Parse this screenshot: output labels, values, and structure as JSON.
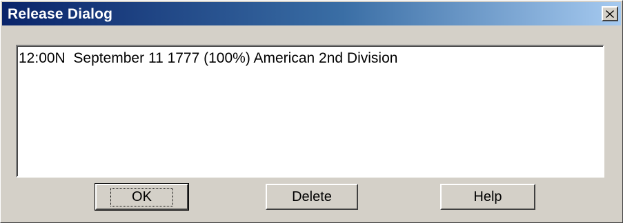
{
  "window": {
    "title": "Release Dialog"
  },
  "icons": {
    "close": "close-icon"
  },
  "list": {
    "items": [
      "12:00N  September 11 1777 (100%) American 2nd Division"
    ]
  },
  "buttons": {
    "ok": "OK",
    "delete": "Delete",
    "help": "Help"
  }
}
